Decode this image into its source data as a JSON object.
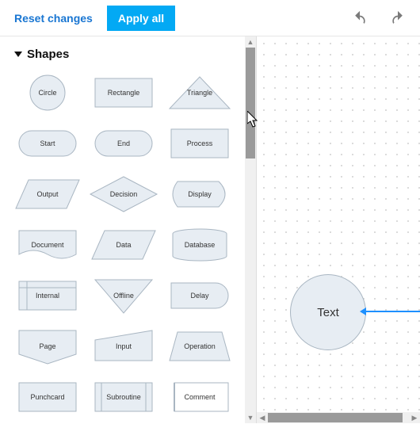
{
  "toolbar": {
    "reset": "Reset changes",
    "apply": "Apply all"
  },
  "section_title": "Shapes",
  "shapes": [
    {
      "label": "Circle",
      "kind": "circle"
    },
    {
      "label": "Rectangle",
      "kind": "rect"
    },
    {
      "label": "Triangle",
      "kind": "triangle"
    },
    {
      "label": "Start",
      "kind": "roundrect"
    },
    {
      "label": "End",
      "kind": "roundrect"
    },
    {
      "label": "Process",
      "kind": "rect"
    },
    {
      "label": "Output",
      "kind": "parallelogram-r"
    },
    {
      "label": "Decision",
      "kind": "diamond"
    },
    {
      "label": "Display",
      "kind": "display"
    },
    {
      "label": "Document",
      "kind": "document"
    },
    {
      "label": "Data",
      "kind": "parallelogram-r"
    },
    {
      "label": "Database",
      "kind": "cylinder"
    },
    {
      "label": "Internal",
      "kind": "internal"
    },
    {
      "label": "Offline",
      "kind": "offline"
    },
    {
      "label": "Delay",
      "kind": "delay"
    },
    {
      "label": "Page",
      "kind": "page"
    },
    {
      "label": "Input",
      "kind": "input"
    },
    {
      "label": "Operation",
      "kind": "operation"
    },
    {
      "label": "Punchcard",
      "kind": "rect"
    },
    {
      "label": "Subroutine",
      "kind": "subroutine"
    },
    {
      "label": "Comment",
      "kind": "comment"
    }
  ],
  "canvas": {
    "node_text": "Text"
  },
  "colors": {
    "accent": "#03a9f4",
    "link": "#1976d2",
    "shape_fill": "#e7edf3",
    "shape_stroke": "#a9b6c2",
    "edge": "#1e90ff"
  }
}
